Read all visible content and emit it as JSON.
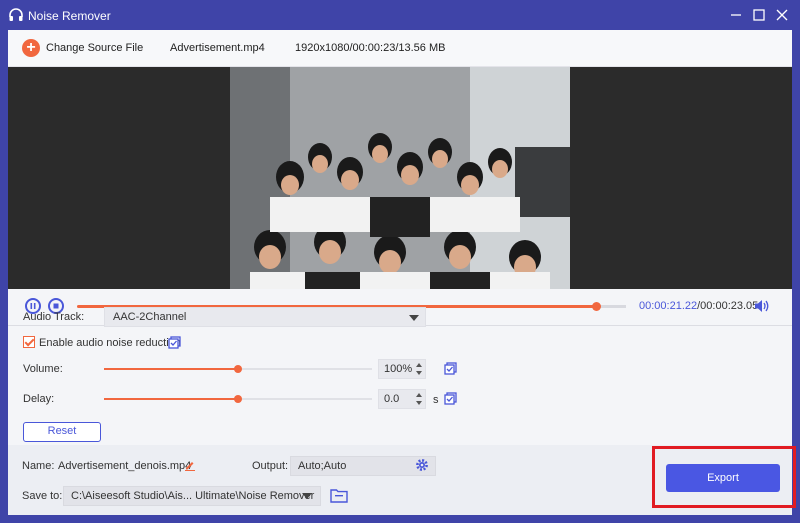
{
  "window": {
    "title": "Noise Remover"
  },
  "toolbar": {
    "change_label": "Change Source File",
    "file_name": "Advertisement.mp4",
    "file_info": "1920x1080/00:00:23/13.56 MB"
  },
  "player": {
    "current_time": "00:00:21.22",
    "total_time": "/00:00:23.05",
    "progress_fraction": 0.92
  },
  "settings": {
    "audio_track_label": "Audio Track:",
    "audio_track_value": "AAC-2Channel",
    "noise_reduction_label": "Enable audio noise reduction",
    "noise_reduction_checked": true,
    "volume_label": "Volume:",
    "volume_value": "100%",
    "volume_level": 0.5,
    "delay_label": "Delay:",
    "delay_value": "0.0",
    "delay_unit": "s",
    "delay_level": 0.5,
    "reset_label": "Reset"
  },
  "output": {
    "name_label": "Name:",
    "name_value": "Advertisement_denois.mp4",
    "output_label": "Output:",
    "output_value": "Auto;Auto",
    "save_label": "Save to:",
    "save_path": "C:\\Aiseesoft Studio\\Ais... Ultimate\\Noise Remover",
    "export_label": "Export"
  },
  "colors": {
    "accent_orange": "#f1673f",
    "accent_blue": "#4a57e3",
    "title_bar": "#3f44a8",
    "highlight_red": "#e11b22"
  }
}
